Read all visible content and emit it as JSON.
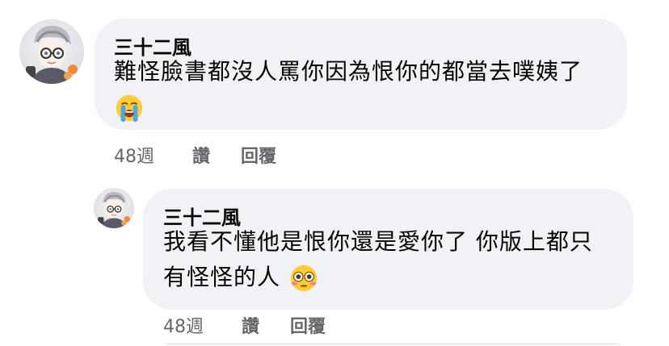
{
  "comments": [
    {
      "author": "三十二風",
      "text_line1": "難怪臉書都沒人罵你因為恨你的都當去噗姨了",
      "emoji": "loudly-crying-face",
      "time": "48週",
      "like_label": "讚",
      "reply_label": "回覆"
    },
    {
      "author": "三十二風",
      "text_line1": "我看不懂他是恨你還是愛你了 你版上都只",
      "text_line2": "有怪怪的人",
      "emoji": "flushed-face",
      "time": "48週",
      "like_label": "讚",
      "reply_label": "回覆"
    }
  ],
  "colors": {
    "bubble": "#f0f2f5",
    "text": "#050505",
    "meta": "#65676b"
  }
}
